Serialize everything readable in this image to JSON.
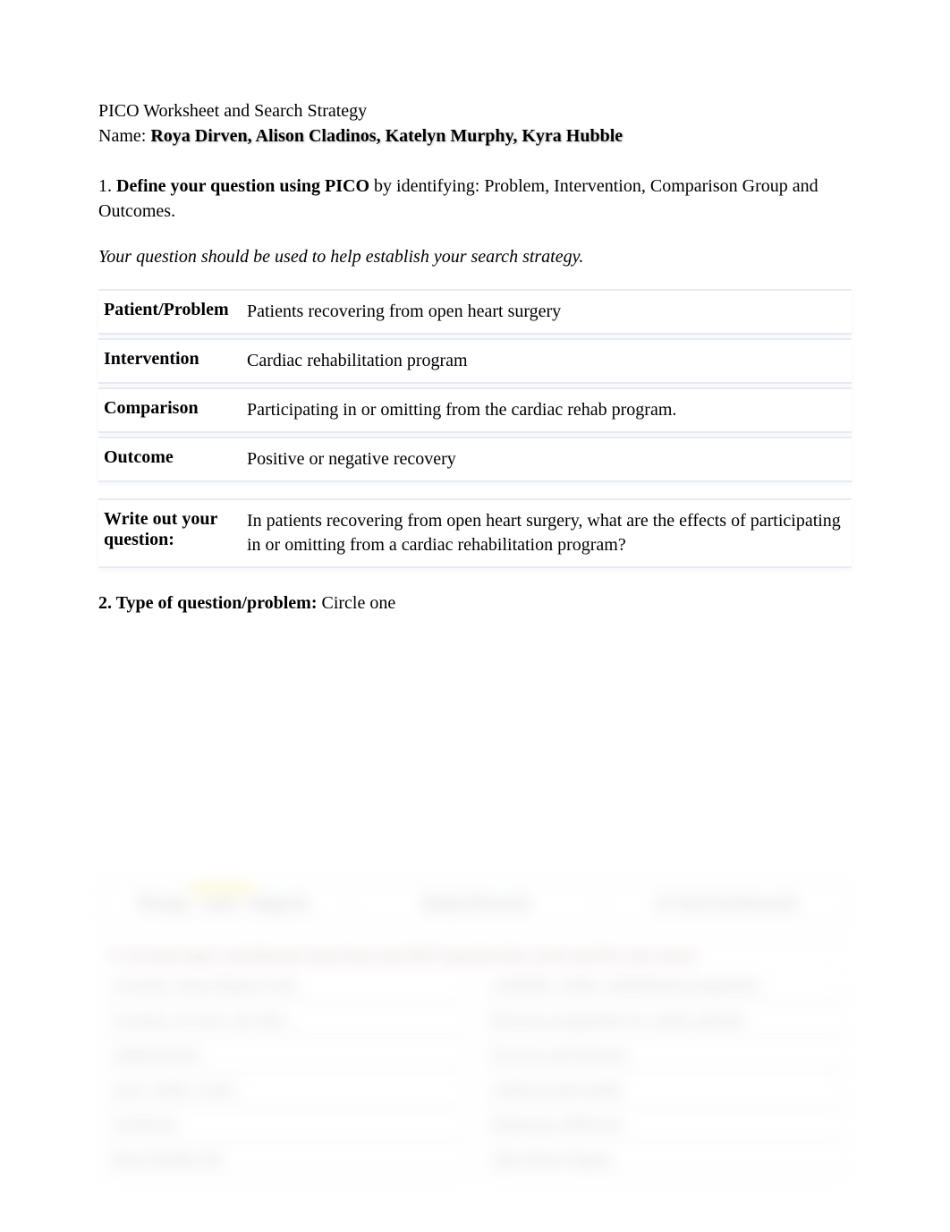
{
  "header": {
    "title": "PICO Worksheet and Search Strategy",
    "name_label": "Name:",
    "names": "Roya Dirven, Alison Cladinos, Katelyn Murphy, Kyra Hubble"
  },
  "section1": {
    "number": "1.",
    "bold_lead": "Define your question using PICO",
    "rest": " by identifying: Problem, Intervention, Comparison Group and Outcomes.",
    "italic_note": "Your question should be used to help establish your search strategy."
  },
  "pico": {
    "rows": [
      {
        "label": "Patient/Problem",
        "value": "Patients recovering from open heart surgery"
      },
      {
        "label": "Intervention",
        "value": "Cardiac rehabilitation program"
      },
      {
        "label": "Comparison",
        "value": "Participating in or omitting from the cardiac rehab program."
      },
      {
        "label": "Outcome",
        "value": "Positive or negative recovery"
      }
    ],
    "question": {
      "label": "Write out your question:",
      "value": "In patients recovering from open heart surgery, what are the effects of participating in or omitting from a cardiac rehabilitation program?"
    }
  },
  "section2": {
    "bold_lead": "2. Type of question/problem:",
    "rest": " Circle one"
  },
  "blurred": {
    "tabs": [
      "Therapy / cause / diagnosis",
      "Animal Research",
      "In Vitro/Lab Research"
    ],
    "subhead": "3. List main topics and alternate terms from your PICO question that can be used for your search.",
    "left": [
      "Coronary Artery Bypass Graft",
      "Coronary recovery rate after ...",
      "randomization",
      "acute cardiac events",
      "recidivism",
      "Heart Healthy life"
    ],
    "right": [
      "cardiORC cardiac rehabilitation programme",
      "Recovery programme for cardiac patients",
      "Exercise and tolerance",
      "cardiovascular health",
      "Pulmonary difference",
      "Open Heart Surgery"
    ]
  }
}
